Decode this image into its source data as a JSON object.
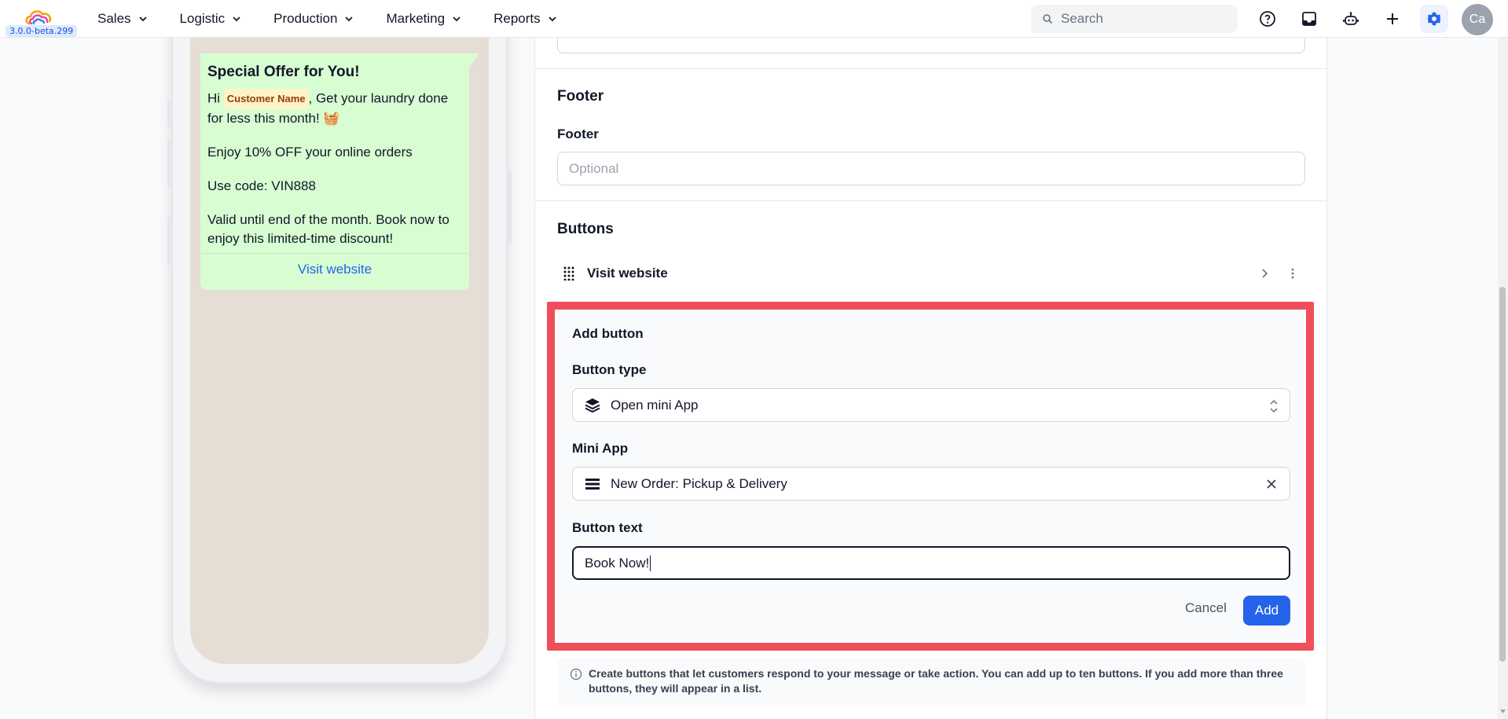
{
  "app": {
    "version": "3.0.0-beta.299",
    "avatar_initials": "Ca",
    "accent": "#2563eb",
    "highlight": "#ef4f5a"
  },
  "nav": {
    "items": [
      {
        "label": "Sales"
      },
      {
        "label": "Logistic"
      },
      {
        "label": "Production"
      },
      {
        "label": "Marketing"
      },
      {
        "label": "Reports"
      }
    ]
  },
  "search": {
    "placeholder": "Search"
  },
  "top_icons": [
    "help-icon",
    "inbox-icon",
    "bot-icon",
    "plus-icon",
    "settings-icon"
  ],
  "preview": {
    "title": "Special Offer for You!",
    "hi": "Hi",
    "customer_tag": "Customer Name",
    "line1_rest": ", Get your laundry done for less this month! 🧺",
    "line2": "Enjoy 10% OFF your online orders",
    "line3": "Use code: VIN888",
    "line4": "Valid until end of the month. Book now to enjoy this limited-time discount!",
    "link": "Visit website"
  },
  "form": {
    "footer_section": "Footer",
    "footer_label": "Footer",
    "footer_placeholder": "Optional",
    "buttons_section": "Buttons",
    "existing_button": "Visit website",
    "add_button": {
      "title": "Add button",
      "type_label": "Button type",
      "type_value": "Open mini App",
      "mini_app_label": "Mini App",
      "mini_app_value": "New Order: Pickup & Delivery",
      "text_label": "Button text",
      "text_value": "Book Now!",
      "cancel": "Cancel",
      "add": "Add"
    },
    "info": "Create buttons that let customers respond to your message or take action. You can add up to ten buttons. If you add more than three buttons, they will appear in a list."
  }
}
